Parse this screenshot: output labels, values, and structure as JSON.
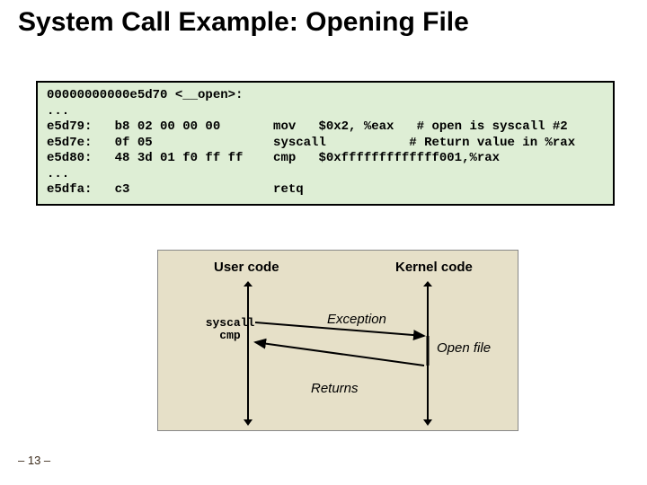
{
  "title": "System Call Example: Opening File",
  "code": "00000000000e5d70 <__open>:\n...\ne5d79:   b8 02 00 00 00       mov   $0x2, %eax   # open is syscall #2\ne5d7e:   0f 05                syscall           # Return value in %rax\ne5d80:   48 3d 01 f0 ff ff    cmp   $0xfffffffffffff001,%rax\n...\ne5dfa:   c3                   retq",
  "diagram": {
    "user_label": "User code",
    "kernel_label": "Kernel code",
    "syscall_label": "syscall\ncmp",
    "exception_label": "Exception",
    "openfile_label": "Open file",
    "returns_label": "Returns"
  },
  "pagenum": "– 13 –",
  "chart_data": {
    "type": "diagram",
    "description": "Control-flow diagram between user code and kernel code for a syscall",
    "columns": [
      "User code",
      "Kernel code"
    ],
    "flows": [
      {
        "from": "User code (syscall)",
        "to": "Kernel code",
        "label": "Exception"
      },
      {
        "from": "Kernel code",
        "to": "Kernel code",
        "label": "Open file",
        "note": "vertical segment in kernel"
      },
      {
        "from": "Kernel code",
        "to": "User code (cmp)",
        "label": "Returns"
      }
    ],
    "user_instructions": [
      "syscall",
      "cmp"
    ]
  }
}
